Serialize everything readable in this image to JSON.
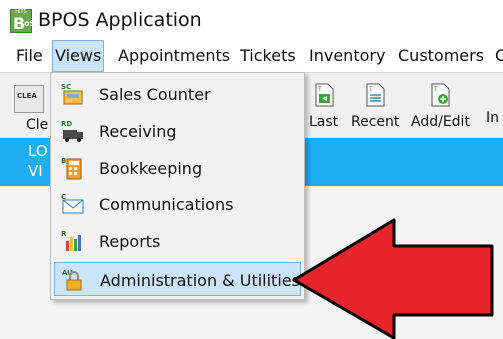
{
  "window": {
    "title": "BPOS Application",
    "app_icon": {
      "top": "HITS",
      "letter": "B",
      "sub": "oS"
    }
  },
  "menubar": {
    "items": [
      "File",
      "Views",
      "Appointments",
      "Tickets",
      "Inventory",
      "Customers",
      "C"
    ]
  },
  "toolbar": {
    "clear": {
      "icon_text": "CLEA",
      "label": "Cle"
    },
    "buttons": [
      {
        "label": "Last",
        "icon": "last-ticket-icon"
      },
      {
        "label": "Recent",
        "icon": "recent-ticket-icon"
      },
      {
        "label": "Add/Edit",
        "icon": "add-edit-ticket-icon"
      },
      {
        "label": "In",
        "icon": "inventory-icon"
      }
    ]
  },
  "status_band": {
    "line1": "LO",
    "line2": "VI",
    "color": "#1faef2"
  },
  "views_menu": {
    "items": [
      {
        "label": "Sales Counter",
        "icon": "sales-counter-icon",
        "tag": "SC"
      },
      {
        "label": "Receiving",
        "icon": "receiving-icon",
        "tag": "RD"
      },
      {
        "label": "Bookkeeping",
        "icon": "bookkeeping-icon",
        "tag": "B"
      },
      {
        "label": "Communications",
        "icon": "communications-icon",
        "tag": "C"
      },
      {
        "label": "Reports",
        "icon": "reports-icon",
        "tag": "R"
      },
      {
        "label": "Administration & Utilities",
        "icon": "administration-lock-icon",
        "tag": "AU"
      }
    ],
    "highlighted_index": 5,
    "highlight_color": "#cce4f7"
  },
  "annotation": {
    "arrow_color": "#e8242c",
    "arrow_outline": "#000000"
  }
}
